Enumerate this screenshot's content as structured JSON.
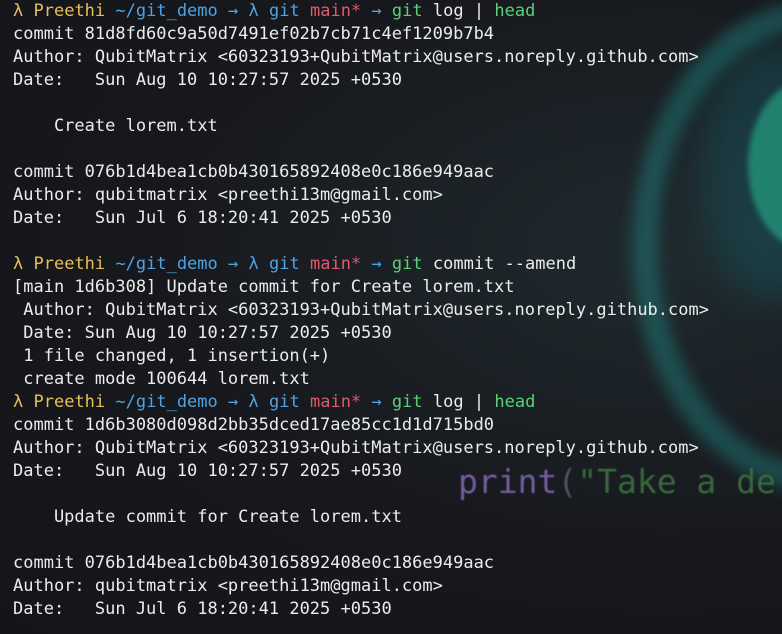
{
  "background": {
    "code_fn": "print",
    "code_paren": "(",
    "code_str": "\"Take a de"
  },
  "prompts": [
    {
      "lambda": "λ",
      "user": "Preethi",
      "path": "~/git_demo",
      "arrow1": "→",
      "lambda2": "λ",
      "git_label": "git",
      "branch": "main*",
      "arrow2": "→",
      "command": "git",
      "args": "log",
      "pipe": "|",
      "command2": "head"
    },
    {
      "lambda": "λ",
      "user": "Preethi",
      "path": "~/git_demo",
      "arrow1": "→",
      "lambda2": "λ",
      "git_label": "git",
      "branch": "main*",
      "arrow2": "→",
      "command": "git",
      "args": "commit --amend"
    },
    {
      "lambda": "λ",
      "user": "Preethi",
      "path": "~/git_demo",
      "arrow1": "→",
      "lambda2": "λ",
      "git_label": "git",
      "branch": "main*",
      "arrow2": "→",
      "command": "git",
      "args": "log",
      "pipe": "|",
      "command2": "head"
    }
  ],
  "output_1": [
    "commit 81d8fd60c9a50d7491ef02b7cb71c4ef1209b7b4",
    "Author: QubitMatrix <60323193+QubitMatrix@users.noreply.github.com>",
    "Date:   Sun Aug 10 10:27:57 2025 +0530",
    "",
    "    Create lorem.txt",
    "",
    "commit 076b1d4bea1cb0b430165892408e0c186e949aac",
    "Author: qubitmatrix <preethi13m@gmail.com>",
    "Date:   Sun Jul 6 18:20:41 2025 +0530",
    ""
  ],
  "output_2": [
    "[main 1d6b308] Update commit for Create lorem.txt",
    " Author: QubitMatrix <60323193+QubitMatrix@users.noreply.github.com>",
    " Date: Sun Aug 10 10:27:57 2025 +0530",
    " 1 file changed, 1 insertion(+)",
    " create mode 100644 lorem.txt"
  ],
  "output_3": [
    "commit 1d6b3080d098d2bb35dced17ae85cc1d1d715bd0",
    "Author: QubitMatrix <60323193+QubitMatrix@users.noreply.github.com>",
    "Date:   Sun Aug 10 10:27:57 2025 +0530",
    "",
    "    Update commit for Create lorem.txt",
    "",
    "commit 076b1d4bea1cb0b430165892408e0c186e949aac",
    "Author: qubitmatrix <preethi13m@gmail.com>",
    "Date:   Sun Jul 6 18:20:41 2025 +0530"
  ]
}
